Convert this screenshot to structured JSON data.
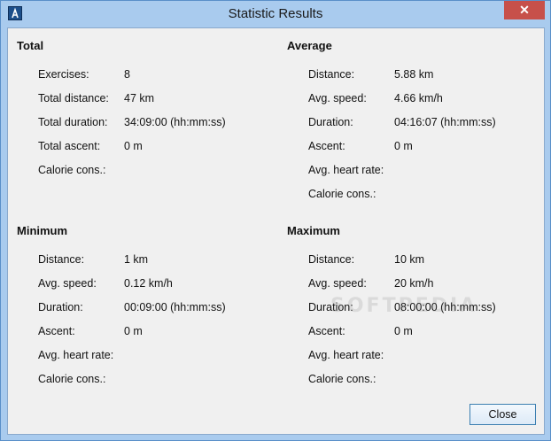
{
  "window": {
    "title": "Statistic Results",
    "close_glyph": "✕"
  },
  "total": {
    "title": "Total",
    "rows": [
      {
        "label": "Exercises:",
        "value": "8"
      },
      {
        "label": "Total distance:",
        "value": "47 km"
      },
      {
        "label": "Total duration:",
        "value": "34:09:00 (hh:mm:ss)"
      },
      {
        "label": "Total ascent:",
        "value": "0 m"
      },
      {
        "label": "Calorie cons.:",
        "value": ""
      }
    ]
  },
  "average": {
    "title": "Average",
    "rows": [
      {
        "label": "Distance:",
        "value": "5.88 km"
      },
      {
        "label": "Avg. speed:",
        "value": "4.66 km/h"
      },
      {
        "label": "Duration:",
        "value": "04:16:07 (hh:mm:ss)"
      },
      {
        "label": "Ascent:",
        "value": "0 m"
      },
      {
        "label": "Avg. heart rate:",
        "value": ""
      },
      {
        "label": "Calorie cons.:",
        "value": ""
      }
    ]
  },
  "minimum": {
    "title": "Minimum",
    "rows": [
      {
        "label": "Distance:",
        "value": "1 km"
      },
      {
        "label": "Avg. speed:",
        "value": "0.12 km/h"
      },
      {
        "label": "Duration:",
        "value": "00:09:00 (hh:mm:ss)"
      },
      {
        "label": "Ascent:",
        "value": "0 m"
      },
      {
        "label": "Avg. heart rate:",
        "value": ""
      },
      {
        "label": "Calorie cons.:",
        "value": ""
      }
    ]
  },
  "maximum": {
    "title": "Maximum",
    "rows": [
      {
        "label": "Distance:",
        "value": "10 km"
      },
      {
        "label": "Avg. speed:",
        "value": "20 km/h"
      },
      {
        "label": "Duration:",
        "value": "08:00:00 (hh:mm:ss)"
      },
      {
        "label": "Ascent:",
        "value": "0 m"
      },
      {
        "label": "Avg. heart rate:",
        "value": ""
      },
      {
        "label": "Calorie cons.:",
        "value": ""
      }
    ]
  },
  "footer": {
    "close_label": "Close"
  },
  "watermark": "SOFTPEDIA",
  "icons": {
    "app": "app-icon",
    "close": "close-icon"
  }
}
